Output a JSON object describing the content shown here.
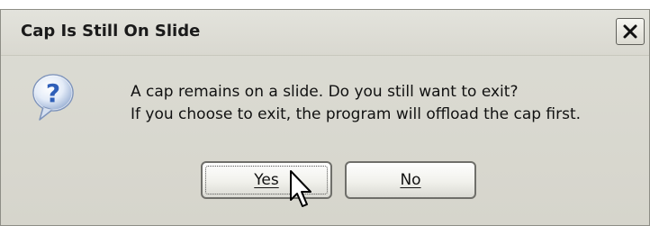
{
  "dialog": {
    "title": "Cap Is Still On Slide",
    "close_icon": "close-icon",
    "message_icon": "question-icon",
    "message_line1": "A cap remains on a slide. Do you still want to exit?",
    "message_line2": "If you choose to exit, the program will offload the cap first.",
    "buttons": {
      "yes_label": "Yes",
      "no_label": "No"
    }
  },
  "colors": {
    "dialog_background": "#d6d5cc",
    "question_icon_blue": "#2f5fb8"
  }
}
